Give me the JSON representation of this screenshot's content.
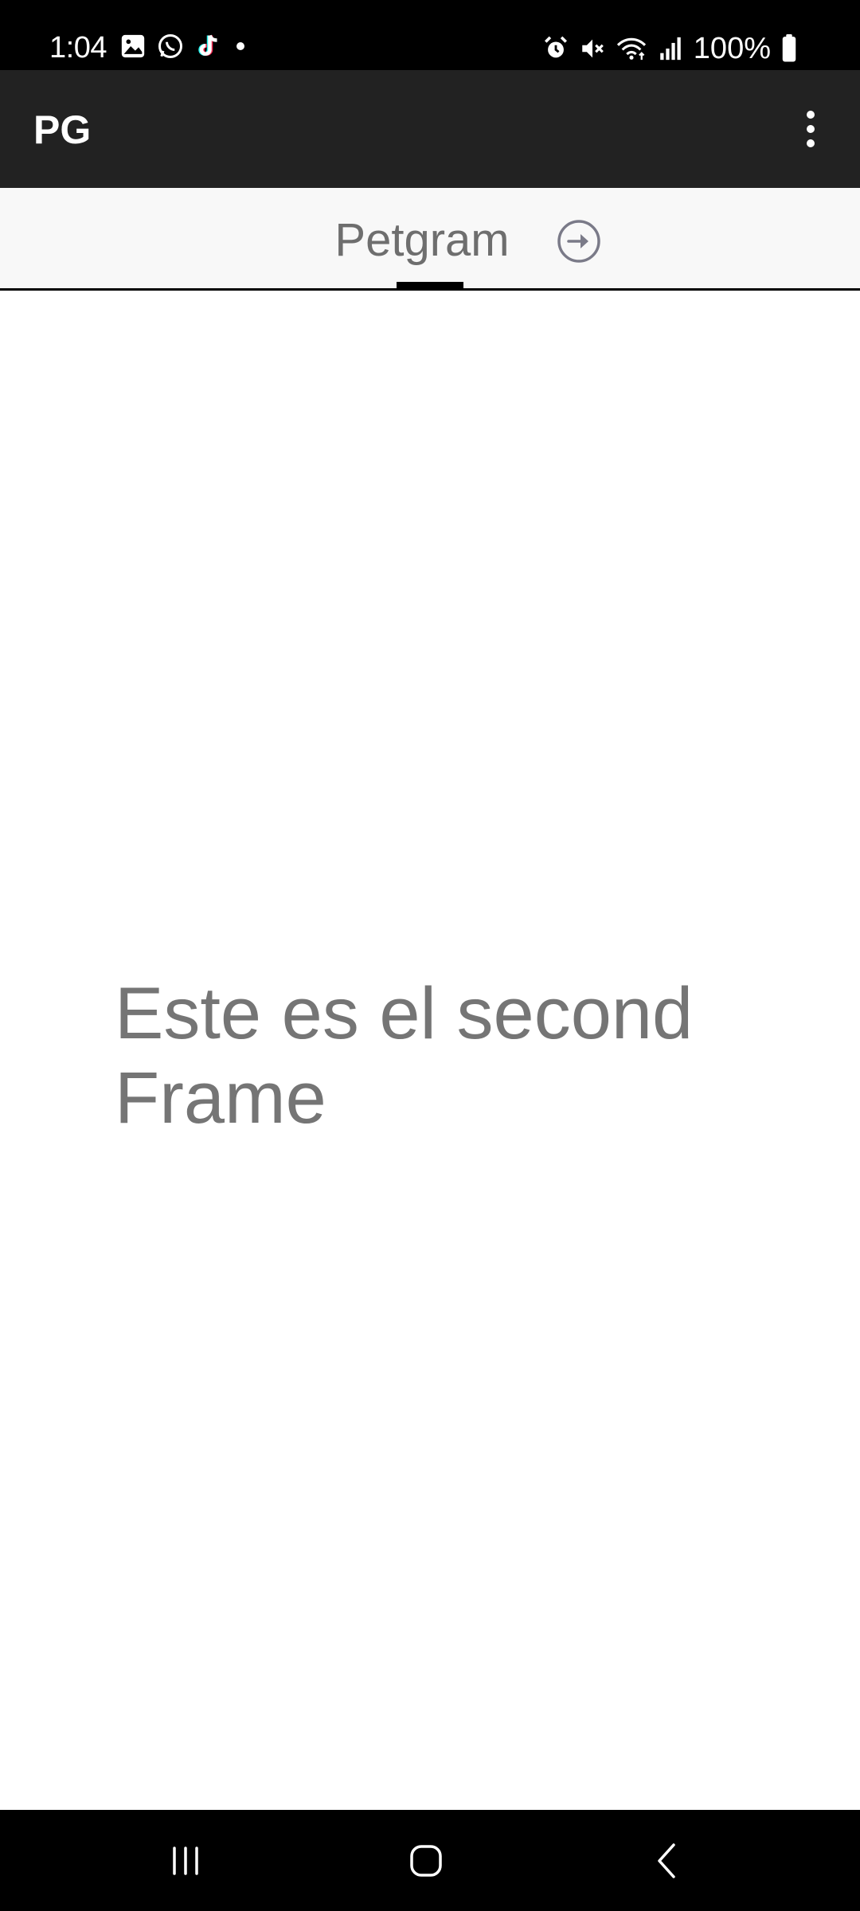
{
  "status_bar": {
    "time": "1:04",
    "battery": "100%",
    "left_icons": [
      "gallery-icon",
      "whatsapp-icon",
      "tiktok-icon",
      "notification-dot-icon"
    ],
    "right_icons": [
      "alarm-icon",
      "mute-icon",
      "wifi-icon",
      "signal-icon",
      "battery-icon"
    ]
  },
  "app_bar": {
    "title": "PG",
    "menu_icon": "more-vert-icon"
  },
  "tabs": [
    {
      "label": "Petgram",
      "selected": true,
      "icon": "arrow-forward-circle-icon"
    }
  ],
  "content": {
    "message": "Este es el second Frame"
  },
  "nav_bar": {
    "buttons": [
      "recent-apps",
      "home",
      "back"
    ]
  },
  "colors": {
    "status_bar": "#000000",
    "app_bar": "#222222",
    "tab_bar": "#f8f8f8",
    "tab_text": "#6e6e6e",
    "content_text": "#757575",
    "indicator": "#000000"
  }
}
